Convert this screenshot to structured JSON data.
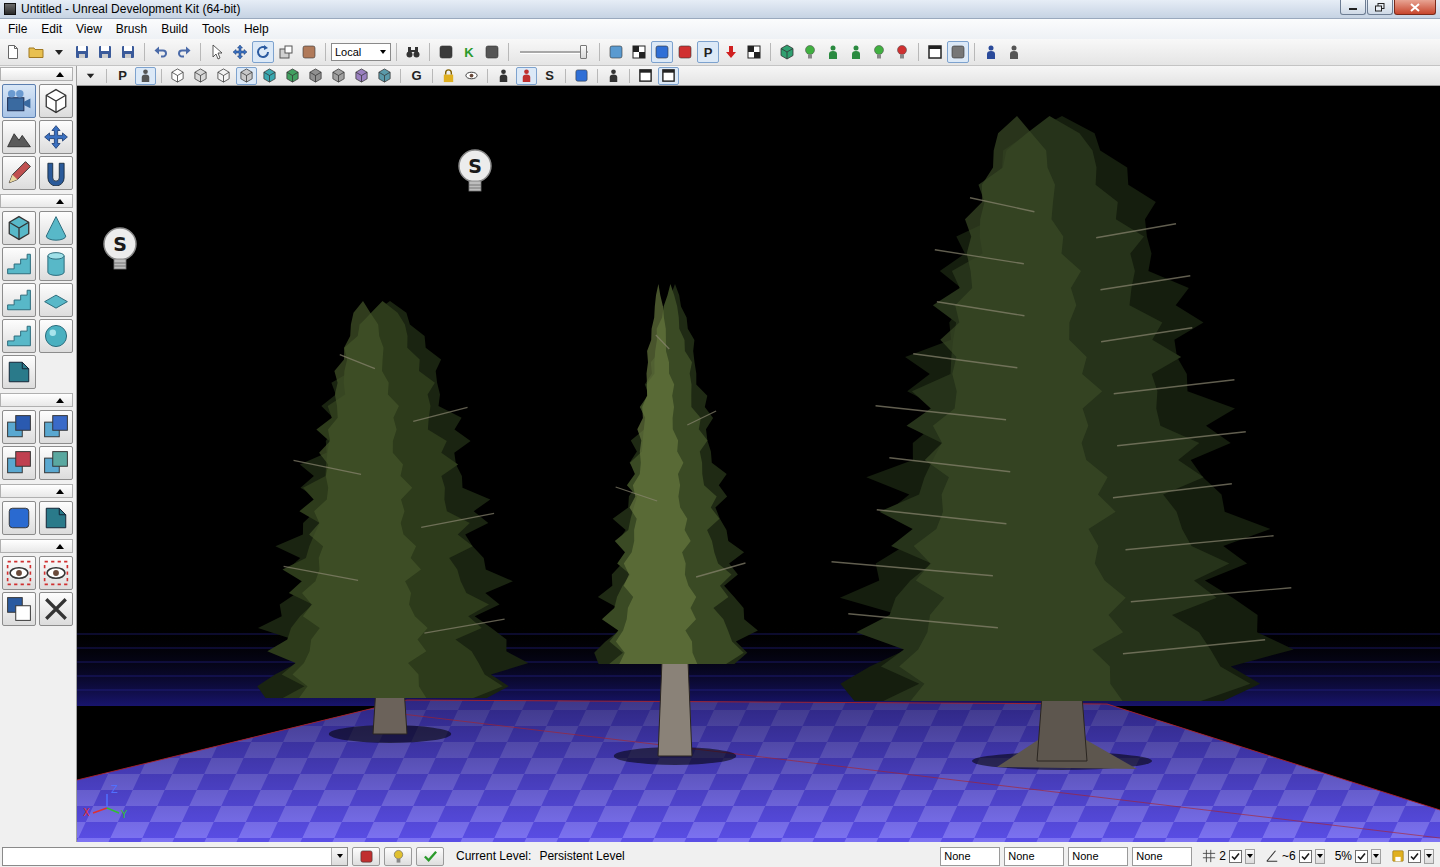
{
  "window": {
    "title": "Untitled - Unreal Development Kit (64-bit)"
  },
  "menu": [
    "File",
    "Edit",
    "View",
    "Brush",
    "Build",
    "Tools",
    "Help"
  ],
  "toolbar": [
    {
      "kind": "page",
      "pressed": false
    },
    {
      "kind": "folder",
      "pressed": false
    },
    {
      "kind": "caret",
      "pressed": false
    },
    {
      "kind": "disk",
      "pressed": false
    },
    {
      "kind": "disk",
      "pressed": false
    },
    {
      "kind": "disk",
      "pressed": false
    },
    {
      "kind": "sep"
    },
    {
      "kind": "undo",
      "pressed": false
    },
    {
      "kind": "redo",
      "pressed": false
    },
    {
      "kind": "sep"
    },
    {
      "kind": "cursor",
      "pressed": false
    },
    {
      "kind": "move",
      "pressed": false
    },
    {
      "kind": "rotate",
      "pressed": true
    },
    {
      "kind": "scale",
      "pressed": false
    },
    {
      "kind": "tile",
      "color": "#b07a5a",
      "pressed": false
    },
    {
      "kind": "sep"
    },
    {
      "kind": "select",
      "label": "Local"
    },
    {
      "kind": "sep"
    },
    {
      "kind": "binoculars",
      "pressed": false
    },
    {
      "kind": "sep"
    },
    {
      "kind": "tile",
      "color": "#3a3a3a",
      "pressed": false
    },
    {
      "kind": "letter",
      "label": "K",
      "color": "#2a9a2a",
      "pressed": false
    },
    {
      "kind": "tile",
      "color": "#555555",
      "pressed": false
    },
    {
      "kind": "sep"
    },
    {
      "kind": "slider",
      "level": 0.95
    },
    {
      "kind": "sep"
    },
    {
      "kind": "tile",
      "color": "#5a9ad0",
      "pressed": false
    },
    {
      "kind": "checker",
      "pressed": false
    },
    {
      "kind": "tile",
      "color": "#2f6fd6",
      "pressed": true
    },
    {
      "kind": "tile",
      "color": "#d03030",
      "pressed": false
    },
    {
      "kind": "letter",
      "label": "P",
      "color": "#222222",
      "pressed": true
    },
    {
      "kind": "arrow",
      "color": "#d02020",
      "pressed": false
    },
    {
      "kind": "checker",
      "pressed": false
    },
    {
      "kind": "sep"
    },
    {
      "kind": "cube",
      "color": "#30a070",
      "pressed": false
    },
    {
      "kind": "bulb",
      "color": "#40b040",
      "pressed": false
    },
    {
      "kind": "figure",
      "color": "#2a8a40",
      "pressed": false
    },
    {
      "kind": "figure",
      "color": "#2a8a40",
      "pressed": false
    },
    {
      "kind": "bulb",
      "color": "#40b040",
      "pressed": false
    },
    {
      "kind": "bulb",
      "color": "#d03030",
      "pressed": false
    },
    {
      "kind": "sep"
    },
    {
      "kind": "window",
      "pressed": false
    },
    {
      "kind": "tile",
      "color": "#777777",
      "pressed": true
    },
    {
      "kind": "sep"
    },
    {
      "kind": "figure",
      "color": "#2a4a9a",
      "pressed": false
    },
    {
      "kind": "figure",
      "color": "#555555",
      "pressed": false
    }
  ],
  "viewport_toolbar": [
    {
      "kind": "caret",
      "pressed": false
    },
    {
      "kind": "sep"
    },
    {
      "kind": "letter",
      "label": "P",
      "color": "#222222",
      "pressed": false
    },
    {
      "kind": "figure",
      "color": "#555555",
      "pressed": true
    },
    {
      "kind": "sep"
    },
    {
      "kind": "cube",
      "color": "#ffffff",
      "pressed": false
    },
    {
      "kind": "cube",
      "color": "#d8d8d8",
      "pressed": false
    },
    {
      "kind": "cube",
      "color": "#f4f4f4",
      "pressed": false
    },
    {
      "kind": "cube",
      "color": "#c8c8c8",
      "pressed": true
    },
    {
      "kind": "cube",
      "color": "#3aa8b0",
      "pressed": false
    },
    {
      "kind": "cube",
      "color": "#40a060",
      "pressed": false
    },
    {
      "kind": "cube",
      "color": "#909090",
      "pressed": false
    },
    {
      "kind": "cube",
      "color": "#a0a0a0",
      "pressed": false
    },
    {
      "kind": "cube",
      "color": "#9a80c0",
      "pressed": false
    },
    {
      "kind": "cube",
      "color": "#5a9aaa",
      "pressed": false
    },
    {
      "kind": "sep"
    },
    {
      "kind": "letter",
      "label": "G",
      "color": "#222222",
      "pressed": false
    },
    {
      "kind": "sep"
    },
    {
      "kind": "lock",
      "pressed": false
    },
    {
      "kind": "eye",
      "pressed": false
    },
    {
      "kind": "sep"
    },
    {
      "kind": "figure",
      "color": "#333333",
      "pressed": false
    },
    {
      "kind": "figure",
      "color": "#c03030",
      "pressed": true
    },
    {
      "kind": "letter",
      "label": "S",
      "color": "#222222",
      "pressed": false
    },
    {
      "kind": "sep"
    },
    {
      "kind": "tile",
      "color": "#2f6fd6",
      "pressed": false
    },
    {
      "kind": "sep"
    },
    {
      "kind": "figure",
      "color": "#333333",
      "pressed": false
    },
    {
      "kind": "sep"
    },
    {
      "kind": "window",
      "pressed": false
    },
    {
      "kind": "window",
      "pressed": true
    }
  ],
  "tool_panel": [
    {
      "expanded": true,
      "tools": [
        {
          "kind": "camera",
          "pressed": true
        },
        {
          "kind": "cube",
          "color": "#ffffff",
          "pressed": false
        },
        {
          "kind": "terrain",
          "pressed": false
        },
        {
          "kind": "move",
          "pressed": false
        },
        {
          "kind": "pen",
          "pressed": false
        },
        {
          "kind": "paint",
          "pressed": false
        }
      ]
    },
    {
      "expanded": true,
      "tools": [
        {
          "kind": "cube",
          "color": "#58b8c8",
          "pressed": false
        },
        {
          "kind": "cone",
          "pressed": false
        },
        {
          "kind": "stairs",
          "pressed": false
        },
        {
          "kind": "cylinder",
          "pressed": false
        },
        {
          "kind": "stairs",
          "pressed": false
        },
        {
          "kind": "sheet",
          "pressed": false
        },
        {
          "kind": "stairs",
          "pressed": false
        },
        {
          "kind": "sphere",
          "pressed": false
        },
        {
          "kind": "volume",
          "pressed": false
        }
      ]
    },
    {
      "expanded": true,
      "tools": [
        {
          "kind": "csg",
          "color": "#2a5ab0",
          "pressed": false
        },
        {
          "kind": "csg",
          "color": "#3a6ac8",
          "pressed": false
        },
        {
          "kind": "csg",
          "color": "#c04050",
          "pressed": false
        },
        {
          "kind": "csg",
          "color": "#5aa8a0",
          "pressed": false
        }
      ]
    },
    {
      "expanded": true,
      "tools": [
        {
          "kind": "tile",
          "color": "#2a6ad0",
          "pressed": false
        },
        {
          "kind": "volume",
          "pressed": false
        }
      ]
    },
    {
      "expanded": true,
      "tools": [
        {
          "kind": "eyebox",
          "color": "#d03030",
          "pressed": false
        },
        {
          "kind": "eyebox",
          "color": "#d03030",
          "pressed": false
        },
        {
          "kind": "invert",
          "pressed": false
        },
        {
          "kind": "cross",
          "pressed": false
        }
      ]
    }
  ],
  "viewport": {
    "lights": [
      {
        "label": "S"
      },
      {
        "label": "S"
      }
    ],
    "trees": [
      {
        "kind": "pine"
      },
      {
        "kind": "spruce"
      },
      {
        "kind": "fir"
      }
    ],
    "axes": [
      "Z",
      "X",
      "Y"
    ]
  },
  "status_bar": {
    "tools": [
      {
        "kind": "tile",
        "color": "#c03030"
      },
      {
        "kind": "bulb",
        "color": "#e0c030"
      },
      {
        "kind": "check",
        "color": "#2a9a2a"
      }
    ],
    "current_level_label": "Current Level:",
    "current_level": "Persistent Level",
    "fields": [
      "None",
      "None",
      "None",
      "None"
    ],
    "snaps": [
      {
        "kind": "grid",
        "value": "2",
        "checked": true
      },
      {
        "kind": "angle",
        "value": "~6",
        "checked": true
      },
      {
        "kind": "percent",
        "value": "5%",
        "checked": true
      },
      {
        "kind": "autosave",
        "checked": true
      }
    ]
  }
}
